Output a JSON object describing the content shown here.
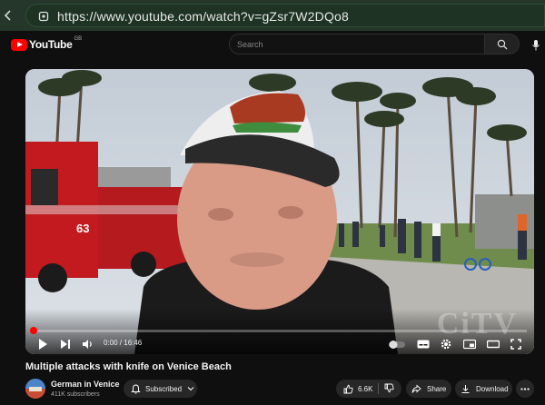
{
  "browser": {
    "url": "https://www.youtube.com/watch?v=gZsr7W2DQo8"
  },
  "masthead": {
    "logo_text": "YouTube",
    "region": "GB",
    "search_placeholder": "Search"
  },
  "player": {
    "time_display": "0:00 / 16:46",
    "progress": 0.0,
    "watermark": "CiTV",
    "truck_number": "63"
  },
  "video": {
    "title": "Multiple attacks with knife on Venice Beach",
    "channel_name": "German in Venice",
    "subscribers": "411K subscribers",
    "subscribed_label": "Subscribed",
    "likes": "6.6K",
    "share_label": "Share",
    "download_label": "Download"
  },
  "colors": {
    "brand_red": "#ff0000",
    "address_bar": "#24372a",
    "background": "#0f0f0f"
  }
}
